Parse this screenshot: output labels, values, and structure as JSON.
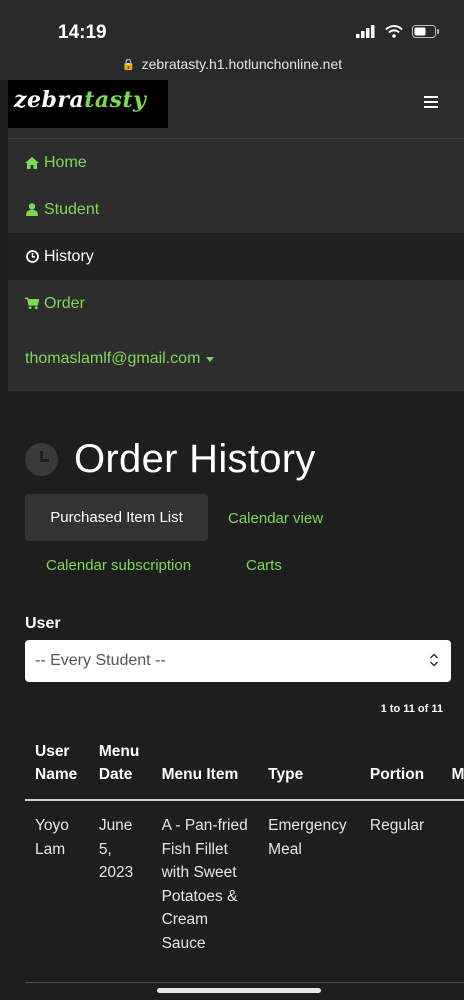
{
  "status": {
    "time": "14:19"
  },
  "browser": {
    "url": "zebratasty.h1.hotlunchonline.net"
  },
  "logo": {
    "part1": "zebra",
    "part2": "tasty"
  },
  "nav": {
    "home": "Home",
    "student": "Student",
    "history": "History",
    "order": "Order",
    "email": "thomaslamlf@gmail.com"
  },
  "page": {
    "title": "Order History"
  },
  "tabs": {
    "purchased": "Purchased Item List",
    "calendar": "Calendar view",
    "subscription": "Calendar subscription",
    "carts": "Carts"
  },
  "filter": {
    "label": "User",
    "selected": "-- Every Student --"
  },
  "pager": {
    "count": "1 to 11 of 11"
  },
  "table": {
    "headers": [
      "User Name",
      "Menu Date",
      "Menu Item",
      "Type",
      "Portion",
      "Me"
    ],
    "rows": [
      [
        "Yoyo Lam",
        "June 5, 2023",
        "A - Pan-fried Fish Fillet with Sweet Potatoes & Cream Sauce",
        "Emergency Meal",
        "Regular",
        ""
      ]
    ]
  },
  "colors": {
    "accent": "#7ed957",
    "background": "#1e1e1e",
    "nav_bg": "#2d2d2d"
  }
}
